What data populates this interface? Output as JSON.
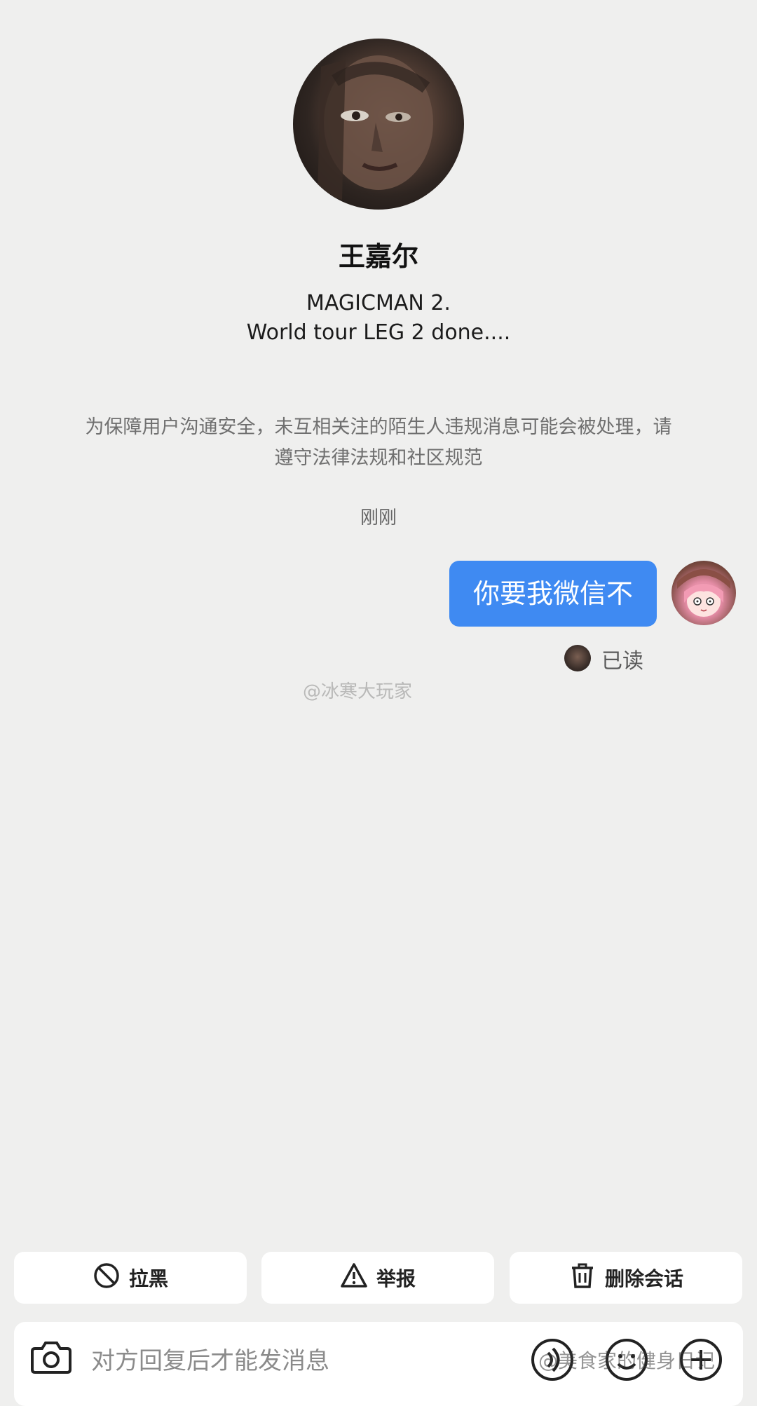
{
  "profile": {
    "name": "王嘉尔",
    "bio": "MAGICMAN 2.\nWorld tour LEG 2 done...."
  },
  "notice": "为保障用户沟通安全，未互相关注的陌生人违规消息可能会被处理，请遵守法律法规和社区规范",
  "conversation": {
    "timestamp": "刚刚",
    "message": "你要我微信不",
    "read_status": "已读"
  },
  "watermarks": [
    "@冰寒大玩家",
    "@美食家的健身日记"
  ],
  "actions": {
    "block_label": "拉黑",
    "report_label": "举报",
    "delete_label": "删除会话"
  },
  "input": {
    "placeholder": "对方回复后才能发消息"
  },
  "colors": {
    "background": "#efefee",
    "bubble": "#3f8af2"
  }
}
